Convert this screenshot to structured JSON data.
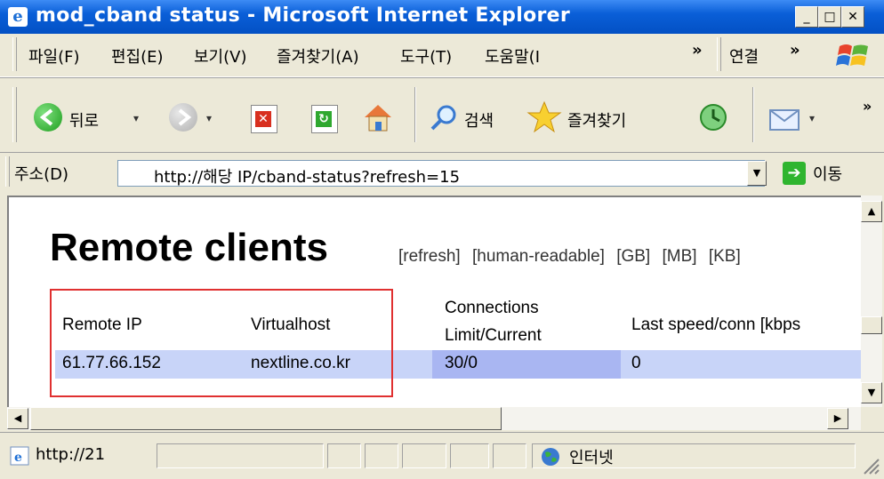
{
  "window": {
    "title": "mod_cband status - Microsoft Internet Explorer",
    "btn_min": "_",
    "btn_max": "□",
    "btn_close": "✕"
  },
  "menubar": {
    "items": [
      "파일(F)",
      "편집(E)",
      "보기(V)",
      "즐겨찾기(A)",
      "도구(T)",
      "도움말(I"
    ],
    "more": "»",
    "links_label": "연결",
    "links_more": "»"
  },
  "toolbar": {
    "back_label": "뒤로",
    "search_label": "검색",
    "favorites_label": "즐겨찾기",
    "more": "»"
  },
  "address": {
    "label": "주소(D)",
    "url": "http://해당 IP/cband-status?refresh=15",
    "go_label": "이동"
  },
  "page": {
    "heading": "Remote clients",
    "links": [
      "[refresh]",
      "[human-readable]",
      "[GB]",
      "[MB]",
      "[KB]"
    ],
    "table": {
      "headers": {
        "remote_ip": "Remote IP",
        "virtualhost": "Virtualhost",
        "connections_line1": "Connections",
        "connections_line2": "Limit/Current",
        "last_speed": "Last speed/conn [kbps"
      },
      "rows": [
        {
          "remote_ip": "61.77.66.152",
          "virtualhost": "nextline.co.kr",
          "connections": "30/0",
          "last_speed": "0"
        }
      ]
    }
  },
  "statusbar": {
    "url": "http://21",
    "zone": "인터넷"
  },
  "colors": {
    "titlebar": "#0a5fd8",
    "row_highlight": "#c8d4f8",
    "annotation_box": "#e03030"
  }
}
